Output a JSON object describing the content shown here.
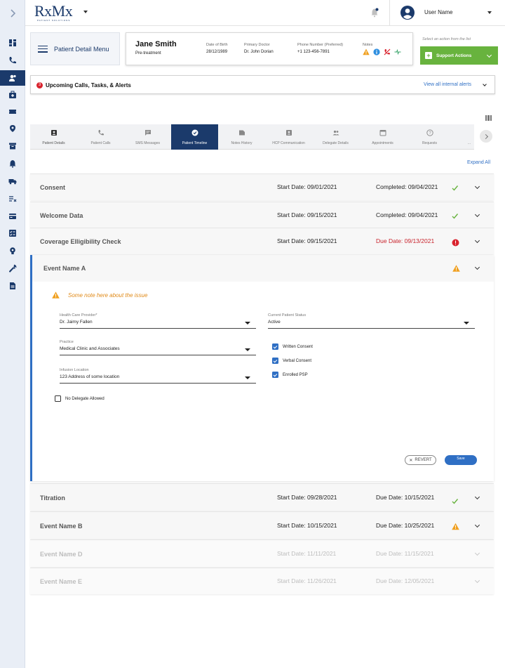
{
  "app": {
    "logo": "RxMx",
    "logo_sub": "PATIENT SOLUTIONS"
  },
  "header": {
    "user_name": "User Name"
  },
  "patient_menu": {
    "label": "Patient Detail Menu"
  },
  "patient": {
    "name": "Jane Smith",
    "status": "Pre-treatment",
    "dob_label": "Date of Birth",
    "dob": "28/12/1989",
    "doctor_label": "Primary Doctor",
    "doctor": "Dr. John Dorian",
    "phone_label": "Phone Number (Preferred)",
    "phone": "+1 123-456-7891",
    "notes_label": "Notes"
  },
  "actions": {
    "hint": "Select an action from the list",
    "support_label": "Support Actions"
  },
  "alerts": {
    "count": "3",
    "title": "Upcoming Calls, Tasks, & Alerts",
    "link": "View all internal alerts"
  },
  "tabs": [
    {
      "label": "Patient Details",
      "icon": "id-card-icon"
    },
    {
      "label": "Patient Calls",
      "icon": "phone-icon"
    },
    {
      "label": "SMS Messages",
      "icon": "message-icon"
    },
    {
      "label": "Patient Timeline",
      "icon": "check-circle-icon"
    },
    {
      "label": "Notes History",
      "icon": "note-icon"
    },
    {
      "label": "HCP Communication",
      "icon": "contact-icon"
    },
    {
      "label": "Delegate Details",
      "icon": "people-icon"
    },
    {
      "label": "Appointments",
      "icon": "calendar-icon"
    },
    {
      "label": "Requests",
      "icon": "help-icon"
    },
    {
      "label": "...",
      "icon": "more-icon"
    }
  ],
  "expand_all": "Expand All",
  "timeline": [
    {
      "name": "Consent",
      "start": "Start Date: 09/01/2021",
      "end": "Completed: 09/04/2021",
      "status": "check"
    },
    {
      "name": "Welcome Data",
      "start": "Start Date: 09/15/2021",
      "end": "Completed: 09/04/2021",
      "status": "check"
    },
    {
      "name": "Coverage Elligibility Check",
      "start": "Start Date: 09/15/2021",
      "end": "Due Date: 09/13/2021",
      "status": "error"
    },
    {
      "name": "Event Name A",
      "start": "",
      "end": "",
      "status": "warning"
    },
    {
      "name": "Titration",
      "start": "Start Date: 09/28/2021",
      "end": "Due Date: 10/15/2021",
      "status": "check"
    },
    {
      "name": "Event Name B",
      "start": "Start Date: 10/15/2021",
      "end": "Due Date: 10/25/2021",
      "status": "warning"
    },
    {
      "name": "Event Name D",
      "start": "Start Date: 11/11/2021",
      "end": "Due Date: 11/15/2021",
      "status": "none"
    },
    {
      "name": "Event Name E",
      "start": "Start Date: 11/26/2021",
      "end": "Due Date: 12/05/2021",
      "status": "none"
    }
  ],
  "event_form": {
    "note": "Some note here about the issue",
    "hcp_label": "Health Care Provider*",
    "hcp_value": "Dr. Jaimy Fallen",
    "status_label": "Current Patient Status",
    "status_value": "Active",
    "practice_label": "Practice",
    "practice_value": "Medical Clinic and Associates",
    "infusion_label": "Infusion Location",
    "infusion_value": "123 Address of some location",
    "written_consent": "Written Consent",
    "verbal_consent": "Verbal Consent",
    "enrolled_psp": "Enrolled PSP",
    "no_delegate": "No Delegate Allowed",
    "revert": "REVERT",
    "save": "Save"
  },
  "colors": {
    "brand": "#1b3a6b",
    "accent": "#2f6fc4",
    "success": "#68b33e",
    "warning": "#f0a020",
    "danger": "#d9232e"
  }
}
